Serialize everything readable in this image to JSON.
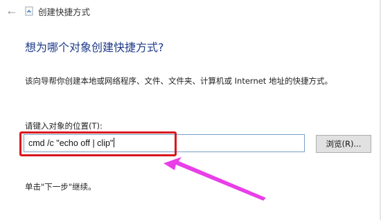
{
  "window": {
    "title": "创建快捷方式"
  },
  "wizard": {
    "heading": "想为哪个对象创建快捷方式?",
    "description": "该向导帮你创建本地或网络程序、文件、文件夹、计算机或 Internet 地址的快捷方式。",
    "location_label": "请键入对象的位置(T):",
    "location_value": "cmd /c \"echo off | clip\"",
    "browse_label": "浏览(R)...",
    "hint": "单击\"下一步\"继续。"
  },
  "annotation": {
    "highlight_color": "#d9141c",
    "arrow_color": "#e83fe8"
  }
}
